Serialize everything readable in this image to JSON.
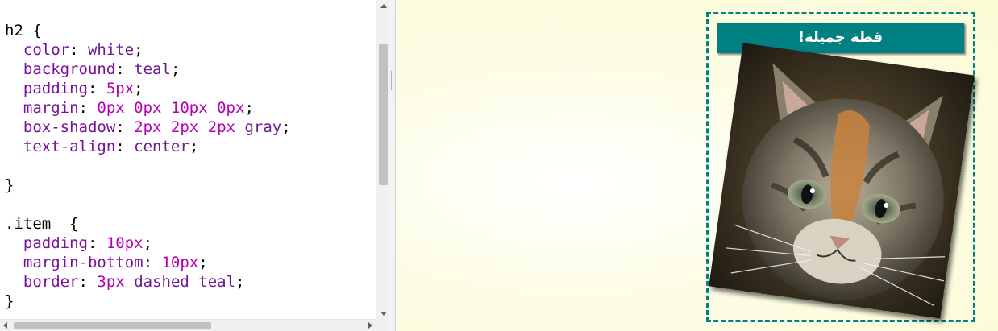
{
  "editor": {
    "lines": [
      [
        {
          "t": "h2 {",
          "c": "tok-plain"
        }
      ],
      [
        {
          "t": "  color",
          "c": "tok-prop"
        },
        {
          "t": ": ",
          "c": "tok-plain"
        },
        {
          "t": "white",
          "c": "tok-val"
        },
        {
          "t": ";",
          "c": "tok-plain"
        }
      ],
      [
        {
          "t": "  background",
          "c": "tok-prop"
        },
        {
          "t": ": ",
          "c": "tok-plain"
        },
        {
          "t": "teal",
          "c": "tok-val"
        },
        {
          "t": ";",
          "c": "tok-plain"
        }
      ],
      [
        {
          "t": "  padding",
          "c": "tok-prop"
        },
        {
          "t": ": ",
          "c": "tok-plain"
        },
        {
          "t": "5px",
          "c": "tok-num"
        },
        {
          "t": ";",
          "c": "tok-plain"
        }
      ],
      [
        {
          "t": "  margin",
          "c": "tok-prop"
        },
        {
          "t": ": ",
          "c": "tok-plain"
        },
        {
          "t": "0px 0px 10px 0px",
          "c": "tok-num"
        },
        {
          "t": ";",
          "c": "tok-plain"
        }
      ],
      [
        {
          "t": "  box-shadow",
          "c": "tok-prop"
        },
        {
          "t": ": ",
          "c": "tok-plain"
        },
        {
          "t": "2px 2px 2px",
          "c": "tok-num"
        },
        {
          "t": " ",
          "c": "tok-plain"
        },
        {
          "t": "gray",
          "c": "tok-val"
        },
        {
          "t": ";",
          "c": "tok-plain"
        }
      ],
      [
        {
          "t": "  text-align",
          "c": "tok-prop"
        },
        {
          "t": ": ",
          "c": "tok-plain"
        },
        {
          "t": "center",
          "c": "tok-val"
        },
        {
          "t": ";",
          "c": "tok-plain"
        }
      ],
      [
        {
          "t": "",
          "c": "tok-plain"
        }
      ],
      [
        {
          "t": "}",
          "c": "tok-plain"
        }
      ],
      [
        {
          "t": "",
          "c": "tok-plain"
        }
      ],
      [
        {
          "t": ".item  {",
          "c": "tok-plain"
        }
      ],
      [
        {
          "t": "  padding",
          "c": "tok-prop"
        },
        {
          "t": ": ",
          "c": "tok-plain"
        },
        {
          "t": "10px",
          "c": "tok-num"
        },
        {
          "t": ";",
          "c": "tok-plain"
        }
      ],
      [
        {
          "t": "  margin-bottom",
          "c": "tok-prop"
        },
        {
          "t": ": ",
          "c": "tok-plain"
        },
        {
          "t": "10px",
          "c": "tok-num"
        },
        {
          "t": ";",
          "c": "tok-plain"
        }
      ],
      [
        {
          "t": "  border",
          "c": "tok-prop"
        },
        {
          "t": ": ",
          "c": "tok-plain"
        },
        {
          "t": "3px",
          "c": "tok-num"
        },
        {
          "t": " ",
          "c": "tok-plain"
        },
        {
          "t": "dashed teal",
          "c": "tok-val"
        },
        {
          "t": ";",
          "c": "tok-plain"
        }
      ],
      [
        {
          "t": "}",
          "c": "tok-plain"
        }
      ]
    ]
  },
  "preview": {
    "heading": "قطة جميلة!",
    "image_icon": "kitten-photo"
  },
  "colors": {
    "teal": "#008080",
    "preview_bg": "#fbfbd5"
  }
}
